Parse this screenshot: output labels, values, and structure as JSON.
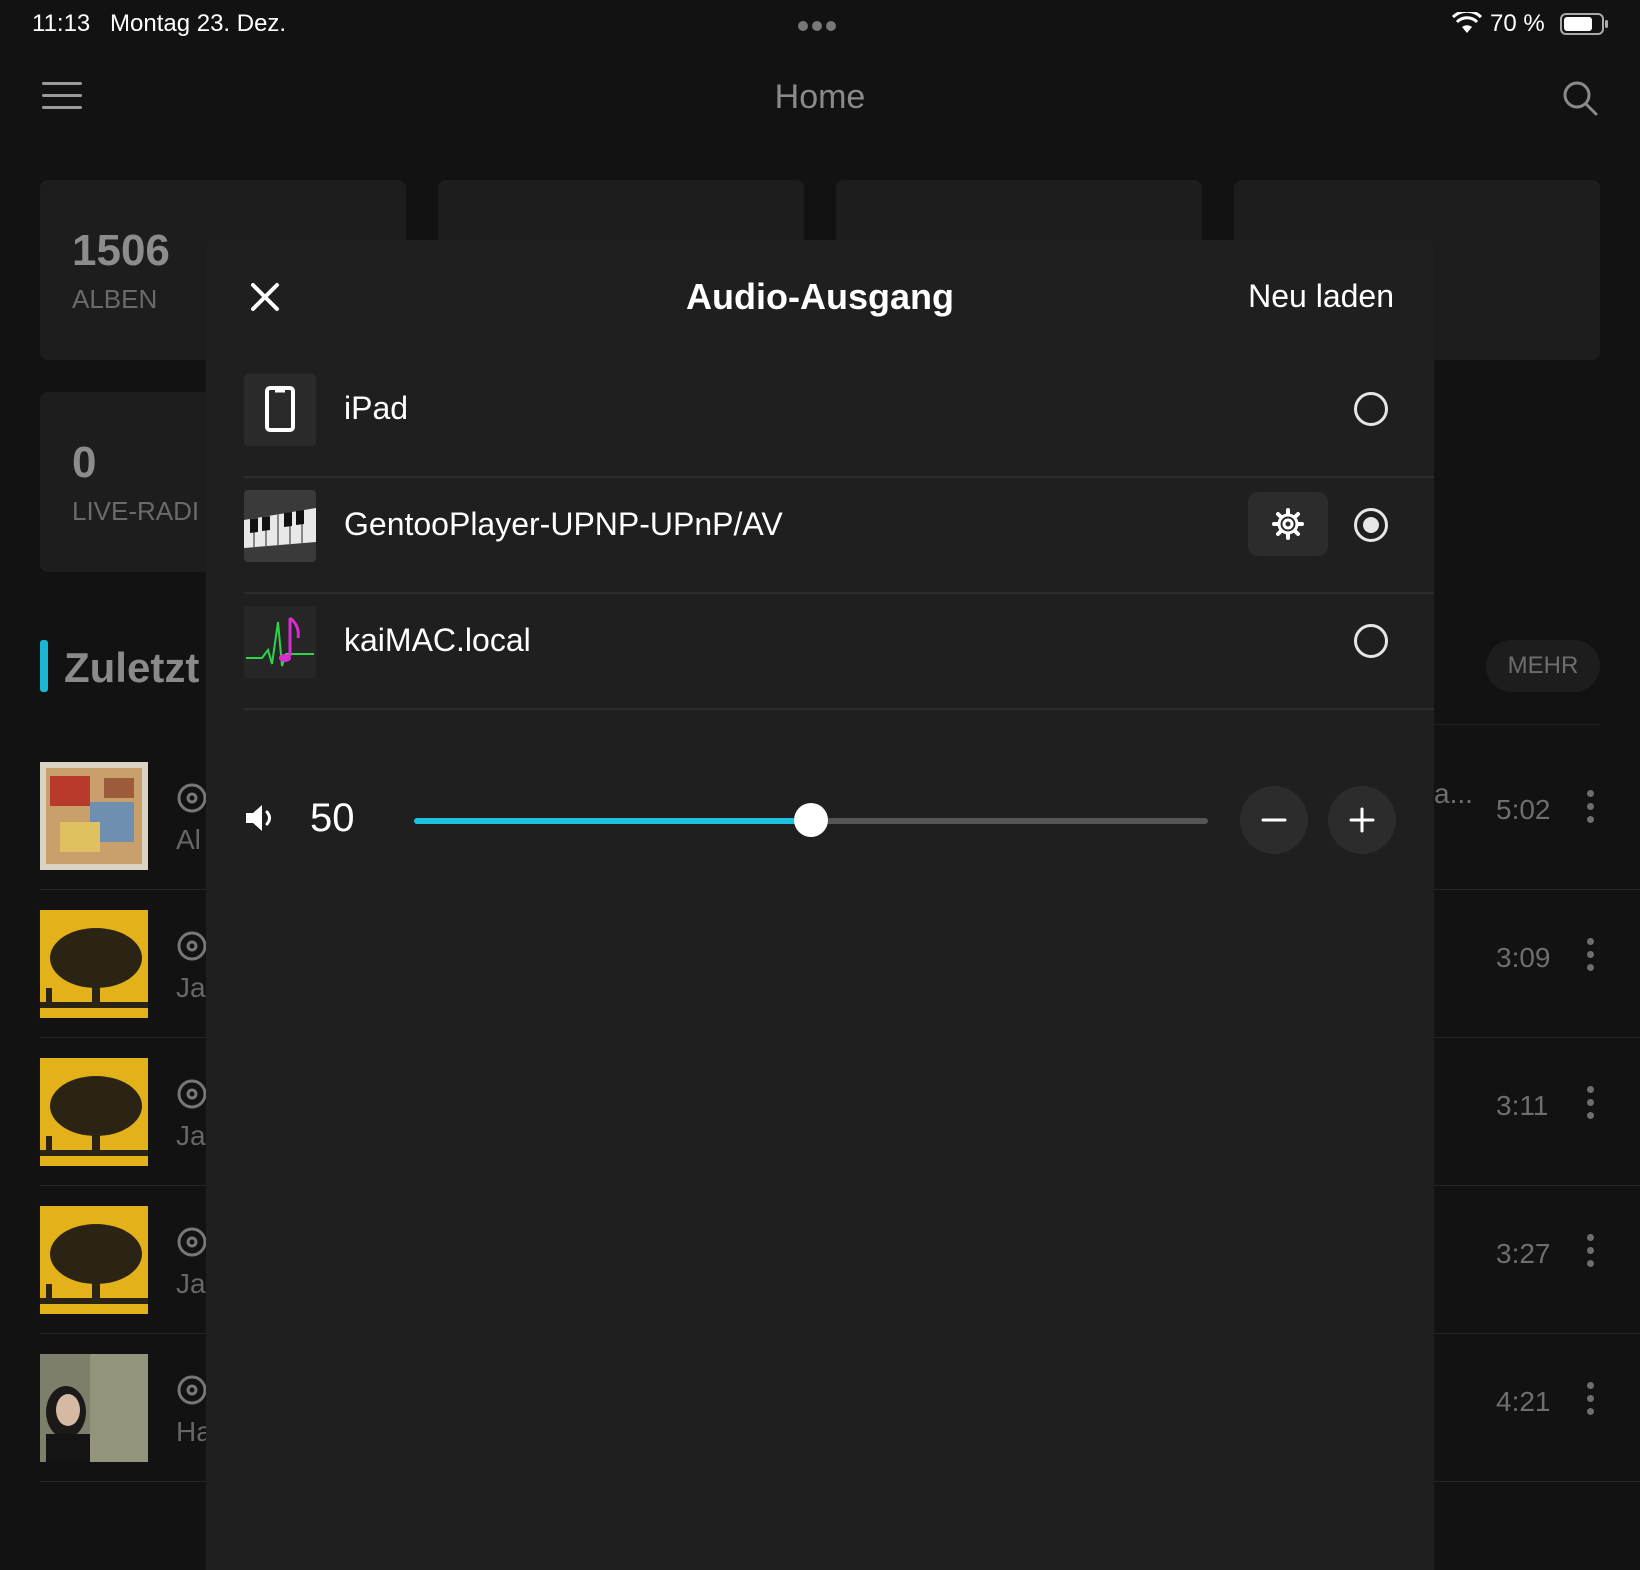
{
  "status_bar": {
    "time": "11:13",
    "date": "Montag 23. Dez.",
    "battery": "70 %"
  },
  "header": {
    "title": "Home"
  },
  "stats": [
    {
      "value": "1506",
      "label": "ALBEN"
    },
    {
      "value": "0",
      "label": "LIVE-RADI"
    }
  ],
  "recent": {
    "title": "Zuletzt",
    "more_label": "MEHR",
    "truncated_text": "a...",
    "tracks": [
      {
        "artist_fragment": "Al",
        "duration": "5:02"
      },
      {
        "artist_fragment": "Ja",
        "duration": "3:09"
      },
      {
        "artist_fragment": "Ja",
        "duration": "3:11"
      },
      {
        "artist_fragment": "Ja",
        "duration": "3:27"
      },
      {
        "artist_fragment": "Ha",
        "duration": "4:21"
      }
    ]
  },
  "modal": {
    "title": "Audio-Ausgang",
    "reload_label": "Neu laden",
    "devices": [
      {
        "name": "iPad",
        "selected": false
      },
      {
        "name": "GentooPlayer-UPNP-UPnP/AV",
        "selected": true
      },
      {
        "name": "kaiMAC.local",
        "selected": false
      }
    ],
    "volume": {
      "value": "50",
      "level_percent": 50
    }
  },
  "colors": {
    "accent": "#1ec0e0",
    "modal_bg": "#1f1f1f",
    "page_bg": "#121212"
  }
}
